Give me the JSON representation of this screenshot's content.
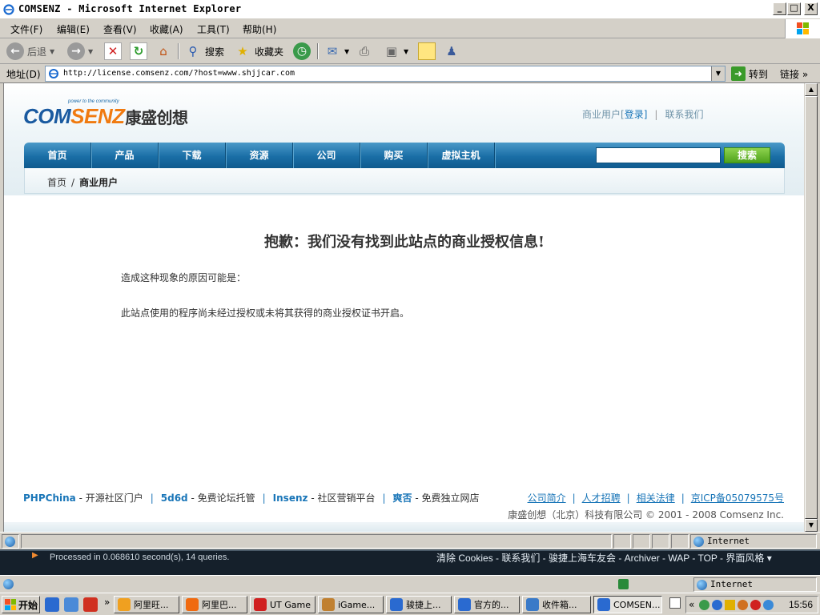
{
  "window": {
    "title": "COMSENZ - Microsoft Internet Explorer",
    "min": "_",
    "max": "□",
    "close": "X"
  },
  "menu": [
    "文件(F)",
    "编辑(E)",
    "查看(V)",
    "收藏(A)",
    "工具(T)",
    "帮助(H)"
  ],
  "toolbar": {
    "back": "后退",
    "search": "搜索",
    "favorites": "收藏夹"
  },
  "address": {
    "label": "地址(D)",
    "url": "http://license.comsenz.com/?host=www.shjjcar.com",
    "go": "转到",
    "links": "链接",
    "more": "»"
  },
  "site": {
    "tagline": "power to the community",
    "brand_left": "COM",
    "brand_right": "SENZ",
    "brand_cn": "康盛创想",
    "top_links": {
      "business": "商业用户[",
      "login": "登录",
      "close": "]",
      "sep": "|",
      "contact": "联系我们"
    },
    "nav": [
      "首页",
      "产品",
      "下载",
      "资源",
      "公司",
      "购买",
      "虚拟主机"
    ],
    "search_button": "搜索",
    "breadcrumb": {
      "home": "首页",
      "sep": "/",
      "current": "商业用户"
    }
  },
  "message": {
    "title": "抱歉：我们没有找到此站点的商业授权信息!",
    "reason_label": "造成这种现象的原因可能是：",
    "reason": "此站点使用的程序尚未经过授权或未将其获得的商业授权证书开启。"
  },
  "footer": {
    "left": [
      {
        "name": "PHPChina",
        "desc": " - 开源社区门户"
      },
      {
        "name": "5d6d",
        "desc": " - 免费论坛托管"
      },
      {
        "name": "Insenz",
        "desc": " - 社区营销平台"
      },
      {
        "name": "爽否",
        "desc": " - 免费独立网店"
      }
    ],
    "sep": "|",
    "right": [
      "公司简介",
      "人才招聘",
      "相关法律",
      "京ICP备05079575号"
    ],
    "copyright": "康盛创想（北京）科技有限公司 © 2001 - 2008 Comsenz Inc."
  },
  "status": {
    "zone": "Internet"
  },
  "second_window": {
    "processed": "Processed in 0.068610 second(s), 14 queries.",
    "links": "清除 Cookies - 联系我们 - 骏捷上海车友会 - Archiver - WAP - TOP - 界面风格 ▾",
    "zone": "Internet"
  },
  "taskbar": {
    "start": "开始",
    "more": "»",
    "tray_more": "«",
    "tasks": [
      {
        "label": "阿里旺...",
        "color": "#f0a020"
      },
      {
        "label": "阿里巴...",
        "color": "#f06a10"
      },
      {
        "label": "UT Game",
        "color": "#d02020"
      },
      {
        "label": "iGame...",
        "color": "#c08030"
      },
      {
        "label": "骏捷上...",
        "color": "#2a6ad0"
      },
      {
        "label": "官方的...",
        "color": "#2a6ad0"
      },
      {
        "label": "收件箱...",
        "color": "#3a7ac8"
      },
      {
        "label": "COMSEN...",
        "color": "#2a6ad0"
      }
    ],
    "clock": "15:56"
  },
  "colors": {
    "accent": "#1a76b8",
    "nav": "#1a6ea6",
    "search_btn": "#4fa21c",
    "brand_blue": "#1a5aa0",
    "brand_orange": "#f07a10"
  }
}
